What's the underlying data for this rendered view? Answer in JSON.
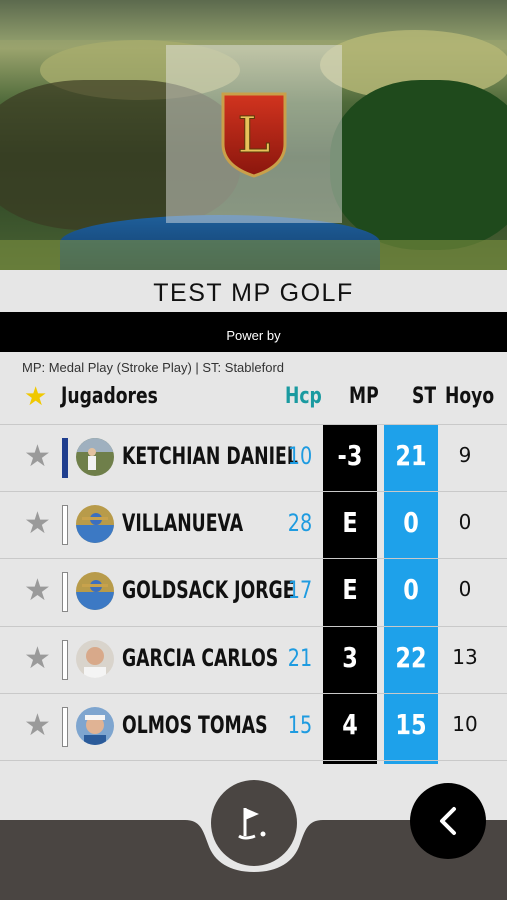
{
  "header": {
    "title": "TEST MP GOLF",
    "power_label": "Power by",
    "legend": "MP: Medal Play (Stroke Play) | ST: Stableford",
    "logo_letter": "L"
  },
  "table": {
    "col_players": "Jugadores",
    "col_hcp": "Hcp",
    "col_mp": "MP",
    "col_st": "ST",
    "col_hoyo": "Hoyo",
    "rows": [
      {
        "name": "KETCHIAN DANIEL",
        "hcp": "10",
        "mp": "-3",
        "st": "21",
        "hoyo": "9",
        "active": true
      },
      {
        "name": "VILLANUEVA",
        "hcp": "28",
        "mp": "E",
        "st": "0",
        "hoyo": "0",
        "active": false
      },
      {
        "name": "GOLDSACK JORGE",
        "hcp": "17",
        "mp": "E",
        "st": "0",
        "hoyo": "0",
        "active": false
      },
      {
        "name": "GARCIA CARLOS",
        "hcp": "21",
        "mp": "3",
        "st": "22",
        "hoyo": "13",
        "active": false
      },
      {
        "name": "OLMOS TOMAS",
        "hcp": "15",
        "mp": "4",
        "st": "15",
        "hoyo": "10",
        "active": false
      }
    ]
  },
  "colors": {
    "accent_blue": "#1ea1ea",
    "hcp_blue": "#1e9be0",
    "hcp_header": "#1a9aa0",
    "star_gold": "#f0c800",
    "active_marker": "#1f3e8e",
    "bottom_bar": "#4a4542"
  },
  "icons": {
    "course": "golf-flag-icon",
    "back": "chevron-left-icon",
    "favorite": "star-icon"
  }
}
